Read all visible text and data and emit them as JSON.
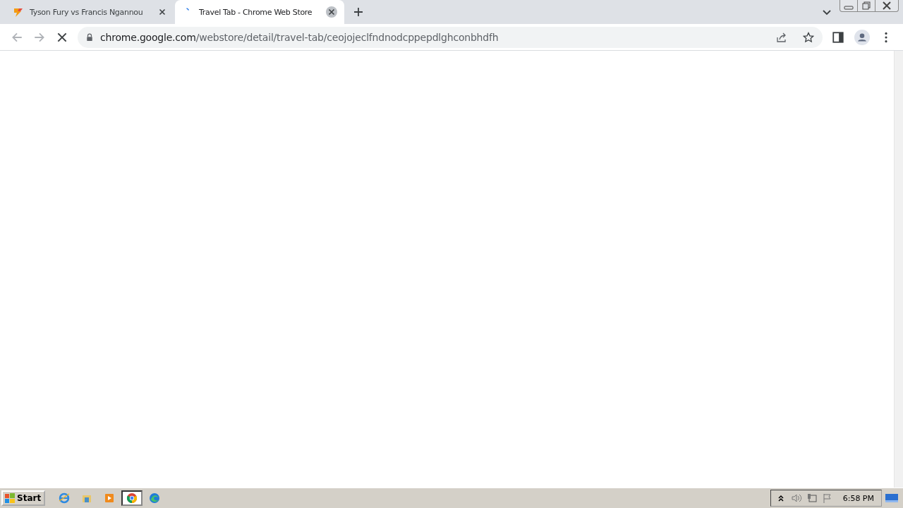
{
  "tabs": [
    {
      "title": "Tyson Fury vs Francis Ngannou",
      "selected": false,
      "kind": "site"
    },
    {
      "title": "Travel Tab - Chrome Web Store",
      "selected": true,
      "kind": "loading"
    }
  ],
  "address_bar": {
    "host": "chrome.google.com",
    "path": "/webstore/detail/travel-tab/ceojojeclfndnodcppepdlghconbhdfh"
  },
  "taskbar": {
    "start": "Start",
    "apps": [
      {
        "kind": "ie",
        "selected": false
      },
      {
        "kind": "folder",
        "selected": false
      },
      {
        "kind": "media",
        "selected": false
      },
      {
        "kind": "chrome",
        "selected": true
      },
      {
        "kind": "edge",
        "selected": false
      }
    ],
    "clock": "6:58 PM"
  }
}
